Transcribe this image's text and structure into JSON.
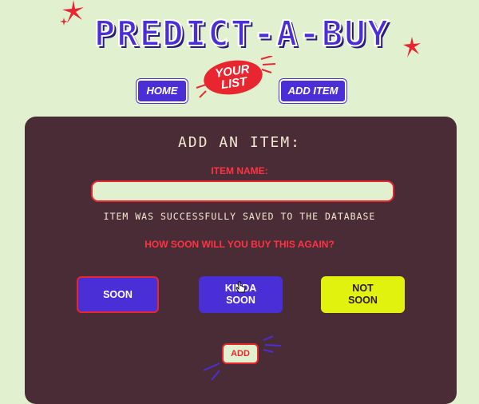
{
  "header": {
    "logo_text": "PREDICT-A-BUY"
  },
  "nav": {
    "home_label": "HOME",
    "your_list_line1": "YOUR",
    "your_list_line2": "LIST",
    "add_item_label": "ADD ITEM"
  },
  "form": {
    "heading": "ADD AN ITEM:",
    "item_name_label": "ITEM NAME:",
    "item_name_value": "",
    "status_message": "ITEM WAS SUCCESSFULLY SAVED TO THE DATABASE",
    "frequency_question": "HOW SOON WILL YOU BUY THIS AGAIN?",
    "options": [
      {
        "label": "SOON"
      },
      {
        "label_line1": "KINDA",
        "label_line2": "SOON"
      },
      {
        "label_line1": "NOT",
        "label_line2": "SOON"
      }
    ],
    "add_label": "ADD"
  },
  "colors": {
    "background": "#e1f0cf",
    "primary_blue": "#4b2fd6",
    "accent_red": "#e8262f",
    "panel": "#4a2c36",
    "not_soon_yellow": "#e2f20f"
  },
  "icons": [
    "sparkle-icon",
    "burst-lines-icon",
    "pointer-cursor-icon"
  ]
}
